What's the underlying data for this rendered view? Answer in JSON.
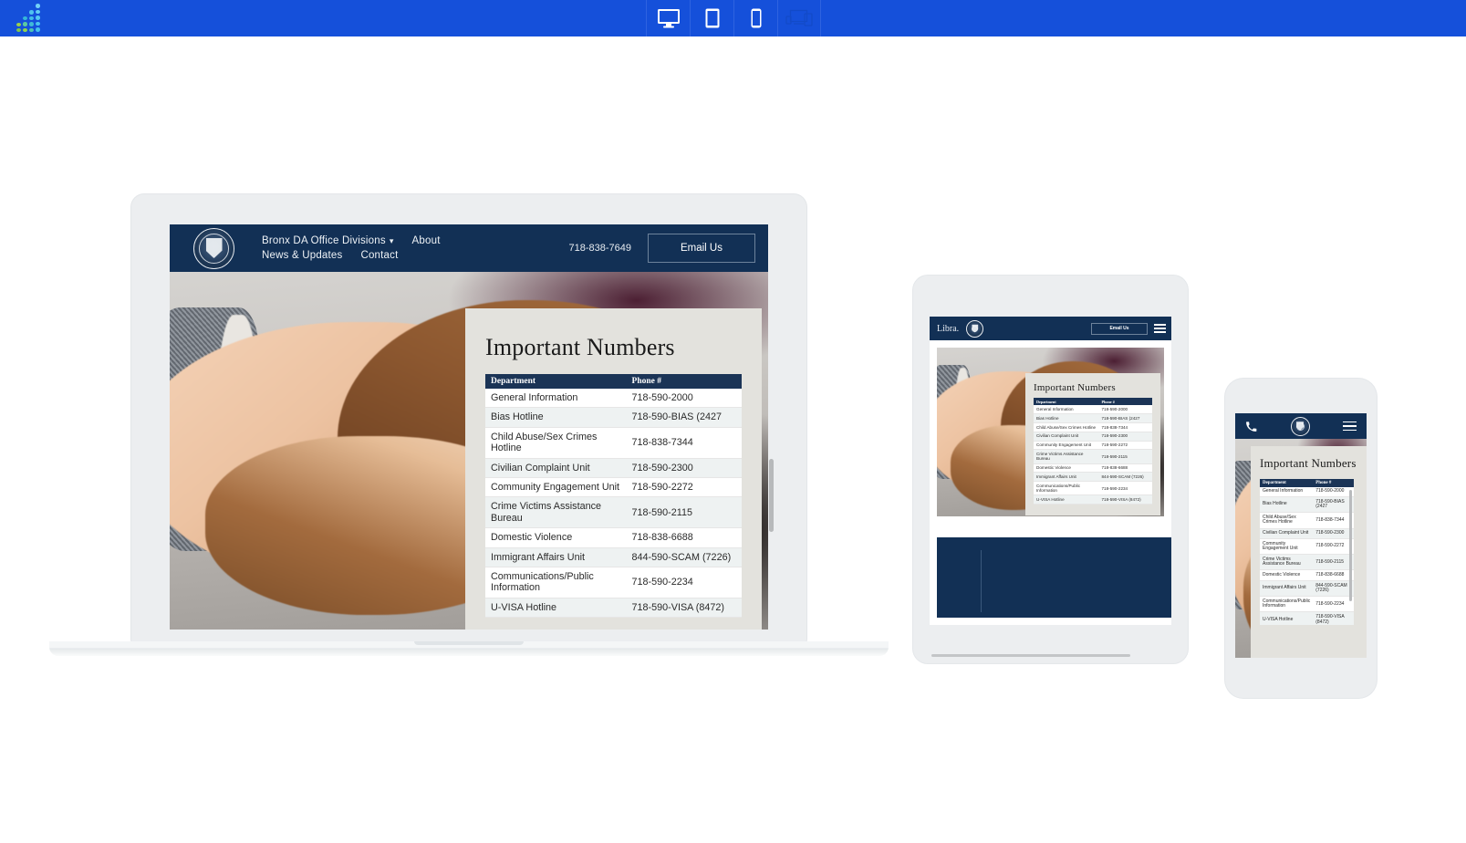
{
  "toolbar": {
    "logo_name": "responsive-preview-logo",
    "background": "#1550da",
    "devices": [
      {
        "name": "desktop",
        "label": "Desktop",
        "active": true
      },
      {
        "name": "tablet",
        "label": "Tablet",
        "active": true
      },
      {
        "name": "mobile",
        "label": "Mobile",
        "active": true
      },
      {
        "name": "all-devices",
        "label": "All Devices",
        "active": false
      }
    ]
  },
  "site": {
    "brand_short": "Libra.",
    "seal_label": "Office of the District Attorney Bronx County seal",
    "nav": [
      {
        "label": "Bronx DA Office Divisions",
        "has_dropdown": true
      },
      {
        "label": "About",
        "has_dropdown": false
      },
      {
        "label": "News & Updates",
        "has_dropdown": false
      },
      {
        "label": "Contact",
        "has_dropdown": false
      }
    ],
    "phone": "718-838-7649",
    "email_button": "Email Us",
    "hero_alt": "Two people shaking hands",
    "card": {
      "title": "Important Numbers",
      "columns": [
        "Department",
        "Phone #"
      ],
      "rows": [
        [
          "General Information",
          "718-590-2000"
        ],
        [
          "Bias Hotline",
          "718-590-BIAS (2427"
        ],
        [
          "Child Abuse/Sex Crimes Hotline",
          "718-838-7344"
        ],
        [
          "Civilian Complaint Unit",
          "718-590-2300"
        ],
        [
          "Community Engagement Unit",
          "718-590-2272"
        ],
        [
          "Crime Victims Assistance Bureau",
          "718-590-2115"
        ],
        [
          "Domestic Violence",
          "718-838-6688"
        ],
        [
          "Immigrant Affairs Unit",
          "844-590-SCAM (7226)"
        ],
        [
          "Communications/Public Information",
          "718-590-2234"
        ],
        [
          "U-VISA Hotline",
          "718-590-VISA (8472)"
        ]
      ]
    }
  },
  "colors": {
    "toolbar_blue": "#1550da",
    "navy": "#123055",
    "table_header_navy": "#1b3456",
    "card_bg": "#e3e2dd",
    "frame_gray": "#eceef0"
  }
}
